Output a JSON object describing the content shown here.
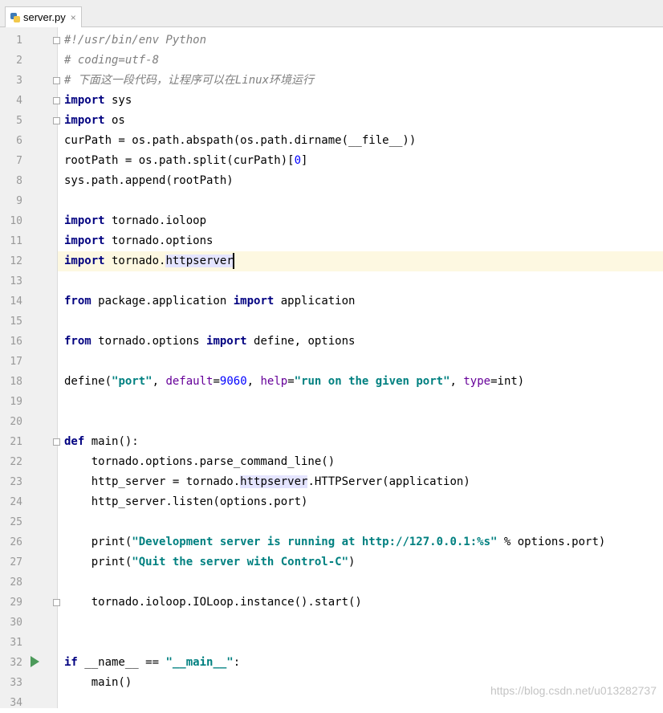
{
  "tab": {
    "filename": "server.py",
    "close_glyph": "×"
  },
  "gutter": {
    "line_numbers": [
      "1",
      "2",
      "3",
      "4",
      "5",
      "6",
      "7",
      "8",
      "9",
      "10",
      "11",
      "12",
      "13",
      "14",
      "15",
      "16",
      "17",
      "18",
      "19",
      "20",
      "21",
      "22",
      "23",
      "24",
      "25",
      "26",
      "27",
      "28",
      "29",
      "30",
      "31",
      "32",
      "33",
      "34"
    ]
  },
  "code": {
    "l1": "#!/usr/bin/env Python",
    "l2": "# coding=utf-8",
    "l3": "# 下面这一段代码，让程序可以在Linux环境运行",
    "kw_import": "import",
    "kw_from": "from",
    "kw_def": "def",
    "kw_if": "if",
    "l4_rest": " sys",
    "l5_rest": " os",
    "l6": "curPath = os.path.abspath(os.path.dirname(__file__))",
    "l7_a": "rootPath = os.path.split(curPath)[",
    "l7_num": "0",
    "l7_b": "]",
    "l8": "sys.path.append(rootPath)",
    "l10_rest": " tornado.ioloop",
    "l11_rest": " tornado.options",
    "l12_a": " tornado.",
    "l12_hl": "httpserver",
    "l14_a": " package.application ",
    "l14_b": " application",
    "l16_a": " tornado.options ",
    "l16_b": " define, options",
    "l18_a": "define(",
    "l18_s1": "\"port\"",
    "l18_b": ", ",
    "l18_p1": "default",
    "l18_c": "=",
    "l18_n": "9060",
    "l18_d": ", ",
    "l18_p2": "help",
    "l18_e": "=",
    "l18_s2": "\"run on the given port\"",
    "l18_f": ", ",
    "l18_p3": "type",
    "l18_g": "=int)",
    "l21_rest": " main():",
    "l22": "    tornado.options.parse_command_line()",
    "l23_a": "    http_server = tornado.",
    "l23_hl": "httpserver",
    "l23_b": ".HTTPServer(application)",
    "l24": "    http_server.listen(options.port)",
    "l26_a": "    print(",
    "l26_s": "\"Development server is running at http://127.0.0.1:%s\"",
    "l26_b": " % options.port)",
    "l27_a": "    print(",
    "l27_s": "\"Quit the server with Control-C\"",
    "l27_b": ")",
    "l29": "    tornado.ioloop.IOLoop.instance().start()",
    "l32_a": " __name__ == ",
    "l32_s": "\"__main__\"",
    "l32_b": ":",
    "l33": "    main()"
  },
  "watermark": "https://blog.csdn.net/u013282737",
  "colors": {
    "keyword": "#000080",
    "string": "#008080",
    "comment": "#808080",
    "param": "#660099",
    "number": "#0000ff",
    "current_line": "#fdf8e1",
    "identifier_highlight": "#e4e4ff",
    "run_icon": "#4c9a5a"
  },
  "icons": {
    "file": "python-file-icon",
    "run": "run-gutter-icon",
    "fold": "fold-marker-icon"
  }
}
